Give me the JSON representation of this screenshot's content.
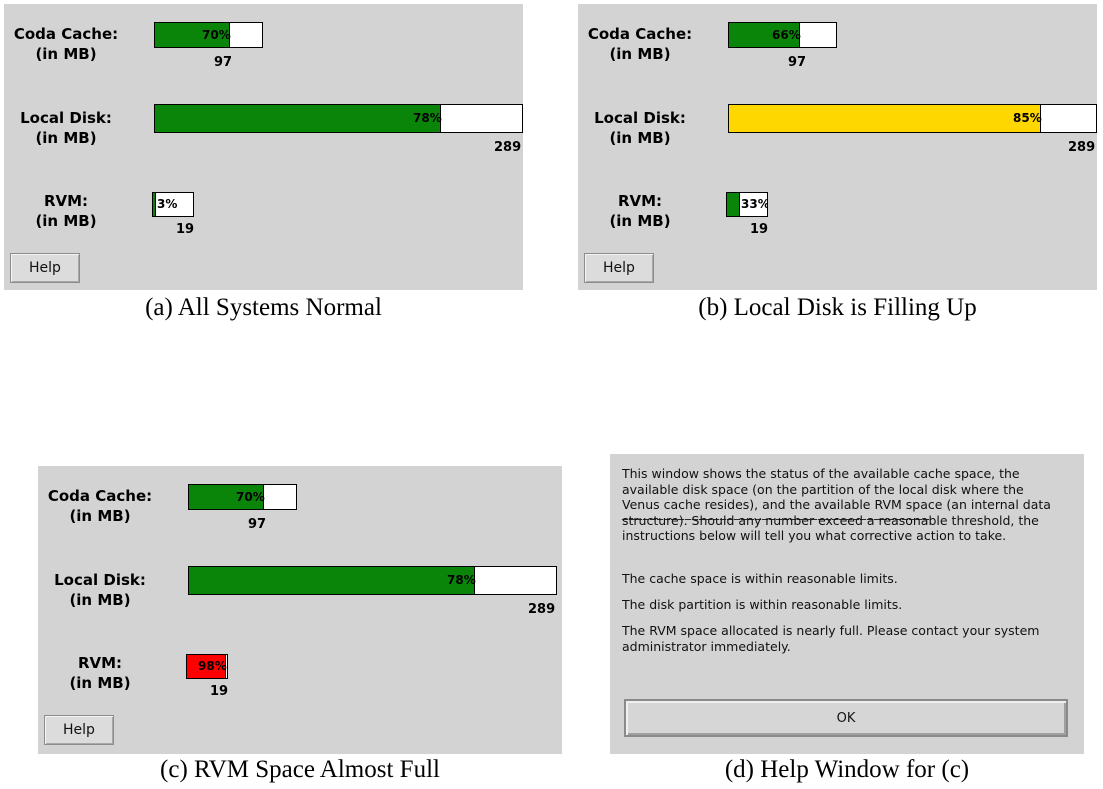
{
  "labels": {
    "coda_cache": "Coda Cache:",
    "local_disk": "Local Disk:",
    "rvm": "RVM:",
    "unit": "(in MB)",
    "help_button": "Help"
  },
  "colors": {
    "green": "#0a850a",
    "yellow": "#ffd700",
    "red": "#ff0000",
    "panel": "#d3d3d3"
  },
  "panels": [
    {
      "caption": "(a) All Systems Normal",
      "meters": [
        {
          "id": "coda_cache",
          "percent": 70,
          "percent_text": "70%",
          "total": "97",
          "color": "green"
        },
        {
          "id": "local_disk",
          "percent": 78,
          "percent_text": "78%",
          "total": "289",
          "color": "green"
        },
        {
          "id": "rvm",
          "percent": 3,
          "percent_text": "3%",
          "total": "19",
          "color": "green"
        }
      ]
    },
    {
      "caption": "(b) Local Disk is Filling Up",
      "meters": [
        {
          "id": "coda_cache",
          "percent": 66,
          "percent_text": "66%",
          "total": "97",
          "color": "green"
        },
        {
          "id": "local_disk",
          "percent": 85,
          "percent_text": "85%",
          "total": "289",
          "color": "yellow"
        },
        {
          "id": "rvm",
          "percent": 33,
          "percent_text": "33%",
          "total": "19",
          "color": "green"
        }
      ]
    },
    {
      "caption": "(c) RVM Space Almost Full",
      "meters": [
        {
          "id": "coda_cache",
          "percent": 70,
          "percent_text": "70%",
          "total": "97",
          "color": "green"
        },
        {
          "id": "local_disk",
          "percent": 78,
          "percent_text": "78%",
          "total": "289",
          "color": "green"
        },
        {
          "id": "rvm",
          "percent": 98,
          "percent_text": "98%",
          "total": "19",
          "color": "red"
        }
      ]
    }
  ],
  "help_window": {
    "caption": "(d) Help Window for (c)",
    "intro": "This window shows the status of the available cache space, the available disk space (on the partition of the local disk where the Venus cache resides), and the available RVM space (an internal data structure).  Should any number exceed a reasonable threshold, the instructions below will tell you what corrective action to take.",
    "separator": "____________________________________________",
    "cache_status": "The cache space is within reasonable limits.",
    "disk_status": "The disk partition is within reasonable limits.",
    "rvm_status": "The RVM space allocated is nearly full.  Please contact your system administrator immediately.",
    "ok_button": "OK"
  }
}
